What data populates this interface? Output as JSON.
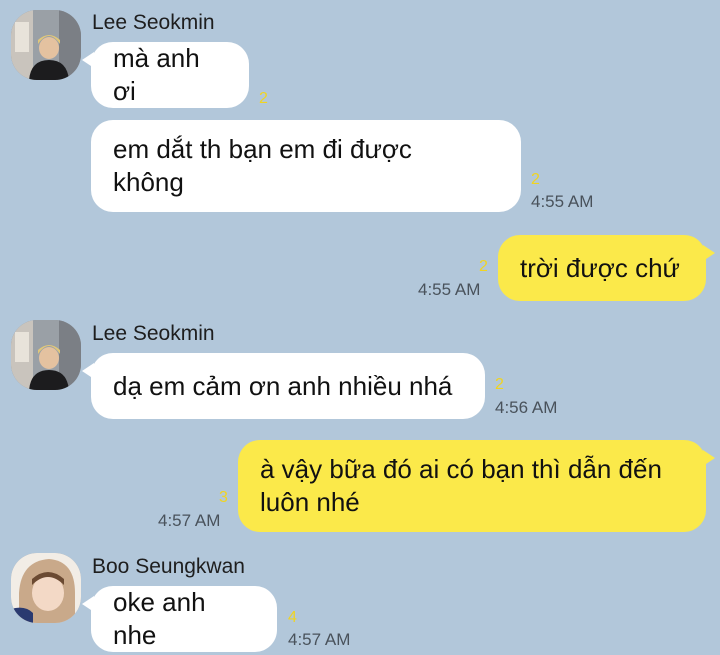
{
  "messages": [
    {
      "sender": "Lee Seokmin",
      "text": "mà anh ơi",
      "read_count": "2",
      "time": ""
    },
    {
      "sender": "Lee Seokmin",
      "text": "em dắt th bạn em đi được\nkhông",
      "read_count": "2",
      "time": "4:55 AM"
    },
    {
      "sender": "me",
      "text": "trời được chứ",
      "read_count": "2",
      "time": "4:55 AM"
    },
    {
      "sender": "Lee Seokmin",
      "text": "dạ em cảm ơn anh nhiều nhá",
      "read_count": "2",
      "time": "4:56 AM"
    },
    {
      "sender": "me",
      "text": "à vậy bữa đó ai có bạn thì dẫn đến\nluôn nhé",
      "read_count": "3",
      "time": "4:57 AM"
    },
    {
      "sender": "Boo Seungkwan",
      "text": "oke anh nhe",
      "read_count": "4",
      "time": "4:57 AM"
    }
  ],
  "senders": {
    "seokmin_1": "Lee Seokmin",
    "seokmin_2": "Lee Seokmin",
    "seungkwan": "Boo Seungkwan"
  },
  "colors": {
    "background": "#b2c7da",
    "incoming_bubble": "#ffffff",
    "outgoing_bubble": "#fbe94a",
    "read_count": "#f0d422",
    "timestamp": "#49525b"
  }
}
